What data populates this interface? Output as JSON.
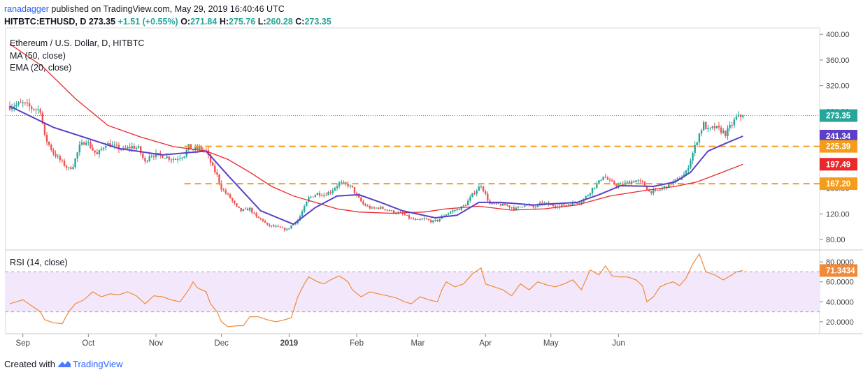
{
  "header": {
    "author": "ranadagger",
    "published_text": " published on TradingView.com, May 29, 2019 16:40:46 UTC",
    "symbol": "HITBTC:ETHUSD, D ",
    "last_price": "273.35",
    "change": "+1.51 (+0.55%)",
    "open_label": "O:",
    "open": "271.84",
    "high_label": "H:",
    "high": "275.76",
    "low_label": "L:",
    "low": "260.28",
    "close_label": "C:",
    "close": "273.35"
  },
  "legend": {
    "title": "Ethereum / U.S. Dollar, D, HITBTC",
    "ma": "MA (50, close)",
    "ema": "EMA (20, close)"
  },
  "rsi_legend": "RSI (14, close)",
  "footer": {
    "prefix": "Created with",
    "brand": "TradingView"
  },
  "colors": {
    "up": "#26a69a",
    "down": "#ef5350",
    "ema": "#5b3fc7",
    "ma": "#e8282a",
    "support": "#f59d1b",
    "rsi": "#f08a3a",
    "rsi_band": "#f3e8fb",
    "last": "#26a69a"
  },
  "chart_data": [
    {
      "type": "candlestick",
      "title": "Ethereum / U.S. Dollar, D, HITBTC",
      "x_ticks": [
        "Sep",
        "Oct",
        "Nov",
        "Dec",
        "2019",
        "Feb",
        "Mar",
        "Apr",
        "May",
        "Jun"
      ],
      "y_ticks": [
        "400.00",
        "360.00",
        "320.00",
        "280.00",
        "240.00",
        "200.00",
        "160.00",
        "120.00",
        "80.00"
      ],
      "ylim": [
        65,
        410
      ],
      "price_path": [
        [
          0,
          288
        ],
        [
          6,
          292
        ],
        [
          10,
          285
        ],
        [
          14,
          282
        ],
        [
          16,
          240
        ],
        [
          20,
          215
        ],
        [
          24,
          200
        ],
        [
          27,
          190
        ],
        [
          29,
          196
        ],
        [
          32,
          225
        ],
        [
          35,
          235
        ],
        [
          38,
          220
        ],
        [
          40,
          212
        ],
        [
          44,
          230
        ],
        [
          48,
          225
        ],
        [
          52,
          220
        ],
        [
          56,
          225
        ],
        [
          59,
          222
        ],
        [
          62,
          200
        ],
        [
          64,
          212
        ],
        [
          67,
          212
        ],
        [
          71,
          210
        ],
        [
          74,
          206
        ],
        [
          76,
          206
        ],
        [
          80,
          212
        ],
        [
          82,
          225
        ],
        [
          84,
          220
        ],
        [
          87,
          222
        ],
        [
          90,
          218
        ],
        [
          93,
          192
        ],
        [
          95,
          180
        ],
        [
          97,
          160
        ],
        [
          101,
          145
        ],
        [
          104,
          130
        ],
        [
          106,
          125
        ],
        [
          110,
          128
        ],
        [
          113,
          115
        ],
        [
          116,
          110
        ],
        [
          118,
          102
        ],
        [
          122,
          100
        ],
        [
          124,
          98
        ],
        [
          127,
          95
        ],
        [
          129,
          102
        ],
        [
          132,
          110
        ],
        [
          135,
          130
        ],
        [
          137,
          145
        ],
        [
          141,
          152
        ],
        [
          144,
          150
        ],
        [
          147,
          155
        ],
        [
          151,
          168
        ],
        [
          155,
          165
        ],
        [
          157,
          160
        ],
        [
          159,
          148
        ],
        [
          162,
          135
        ],
        [
          166,
          128
        ],
        [
          169,
          130
        ],
        [
          172,
          128
        ],
        [
          174,
          125
        ],
        [
          177,
          122
        ],
        [
          180,
          120
        ],
        [
          184,
          112
        ],
        [
          187,
          110
        ],
        [
          190,
          112
        ],
        [
          194,
          108
        ],
        [
          196,
          110
        ],
        [
          199,
          118
        ],
        [
          203,
          125
        ],
        [
          206,
          128
        ],
        [
          209,
          135
        ],
        [
          212,
          150
        ],
        [
          216,
          165
        ],
        [
          218,
          150
        ],
        [
          220,
          135
        ],
        [
          224,
          135
        ],
        [
          228,
          133
        ],
        [
          232,
          128
        ],
        [
          236,
          135
        ],
        [
          240,
          130
        ],
        [
          244,
          137
        ],
        [
          248,
          134
        ],
        [
          252,
          132
        ],
        [
          256,
          135
        ],
        [
          260,
          138
        ],
        [
          262,
          140
        ],
        [
          265,
          150
        ],
        [
          267,
          160
        ],
        [
          270,
          170
        ],
        [
          272,
          180
        ],
        [
          275,
          170
        ],
        [
          278,
          165
        ],
        [
          280,
          165
        ],
        [
          284,
          170
        ],
        [
          287,
          172
        ],
        [
          290,
          168
        ],
        [
          293,
          155
        ],
        [
          296,
          155
        ],
        [
          299,
          160
        ],
        [
          302,
          165
        ],
        [
          304,
          170
        ],
        [
          307,
          175
        ],
        [
          310,
          185
        ],
        [
          313,
          215
        ],
        [
          316,
          245
        ],
        [
          318,
          260
        ],
        [
          320,
          250
        ],
        [
          323,
          255
        ],
        [
          326,
          250
        ],
        [
          328,
          245
        ],
        [
          331,
          260
        ],
        [
          333,
          270
        ],
        [
          336,
          273.35
        ]
      ],
      "series": [
        {
          "name": "EMA (20, close)",
          "points": [
            [
              0,
              288
            ],
            [
              20,
              255
            ],
            [
              50,
              222
            ],
            [
              70,
              212
            ],
            [
              90,
              218
            ],
            [
              100,
              180
            ],
            [
              115,
              125
            ],
            [
              130,
              104
            ],
            [
              140,
              130
            ],
            [
              150,
              148
            ],
            [
              160,
              150
            ],
            [
              170,
              138
            ],
            [
              180,
              125
            ],
            [
              195,
              114
            ],
            [
              205,
              118
            ],
            [
              215,
              138
            ],
            [
              225,
              138
            ],
            [
              240,
              134
            ],
            [
              260,
              138
            ],
            [
              270,
              150
            ],
            [
              280,
              164
            ],
            [
              295,
              163
            ],
            [
              305,
              170
            ],
            [
              312,
              185
            ],
            [
              320,
              218
            ],
            [
              328,
              230
            ],
            [
              336,
              241.34
            ]
          ]
        },
        {
          "name": "MA (50, close)",
          "points": [
            [
              0,
              385
            ],
            [
              15,
              350
            ],
            [
              30,
              300
            ],
            [
              45,
              258
            ],
            [
              60,
              240
            ],
            [
              75,
              225
            ],
            [
              90,
              218
            ],
            [
              100,
              205
            ],
            [
              110,
              185
            ],
            [
              120,
              163
            ],
            [
              130,
              148
            ],
            [
              140,
              138
            ],
            [
              150,
              128
            ],
            [
              160,
              123
            ],
            [
              175,
              121
            ],
            [
              190,
              123
            ],
            [
              200,
              128
            ],
            [
              215,
              132
            ],
            [
              230,
              126
            ],
            [
              245,
              128
            ],
            [
              260,
              134
            ],
            [
              275,
              148
            ],
            [
              290,
              156
            ],
            [
              305,
              163
            ],
            [
              315,
              170
            ],
            [
              325,
              183
            ],
            [
              336,
              197.49
            ]
          ]
        }
      ],
      "support_levels": [
        225.39,
        167.2
      ],
      "price_labels": [
        {
          "label": "273.35",
          "value": 273.35
        },
        {
          "label": "241.34",
          "value": 241.34
        },
        {
          "label": "225.39",
          "value": 225.39
        },
        {
          "label": "197.49",
          "value": 197.49
        },
        {
          "label": "167.20",
          "value": 167.2
        }
      ]
    },
    {
      "type": "line",
      "title": "RSI (14, close)",
      "y_ticks": [
        "80.0000",
        "60.0000",
        "40.0000",
        "20.0000"
      ],
      "ylim": [
        8,
        92
      ],
      "band": [
        30,
        70
      ],
      "last_label": "71.3434",
      "last_value": 71.34,
      "points": [
        [
          0,
          38
        ],
        [
          6,
          42
        ],
        [
          10,
          36
        ],
        [
          14,
          30
        ],
        [
          16,
          22
        ],
        [
          20,
          19
        ],
        [
          24,
          18
        ],
        [
          27,
          30
        ],
        [
          30,
          38
        ],
        [
          34,
          42
        ],
        [
          38,
          50
        ],
        [
          42,
          45
        ],
        [
          46,
          48
        ],
        [
          50,
          47
        ],
        [
          54,
          50
        ],
        [
          58,
          46
        ],
        [
          62,
          38
        ],
        [
          66,
          46
        ],
        [
          70,
          45
        ],
        [
          74,
          42
        ],
        [
          78,
          40
        ],
        [
          82,
          52
        ],
        [
          84,
          60
        ],
        [
          86,
          54
        ],
        [
          90,
          50
        ],
        [
          92,
          38
        ],
        [
          95,
          30
        ],
        [
          97,
          20
        ],
        [
          100,
          15
        ],
        [
          104,
          16
        ],
        [
          107,
          16
        ],
        [
          110,
          25
        ],
        [
          114,
          25
        ],
        [
          118,
          22
        ],
        [
          122,
          20
        ],
        [
          126,
          22
        ],
        [
          129,
          24
        ],
        [
          132,
          45
        ],
        [
          135,
          58
        ],
        [
          137,
          65
        ],
        [
          141,
          60
        ],
        [
          144,
          58
        ],
        [
          147,
          62
        ],
        [
          151,
          66
        ],
        [
          155,
          60
        ],
        [
          157,
          52
        ],
        [
          161,
          45
        ],
        [
          165,
          50
        ],
        [
          169,
          48
        ],
        [
          173,
          46
        ],
        [
          177,
          44
        ],
        [
          181,
          40
        ],
        [
          184,
          38
        ],
        [
          188,
          45
        ],
        [
          192,
          42
        ],
        [
          196,
          40
        ],
        [
          198,
          52
        ],
        [
          200,
          60
        ],
        [
          204,
          55
        ],
        [
          208,
          58
        ],
        [
          212,
          68
        ],
        [
          216,
          74
        ],
        [
          218,
          58
        ],
        [
          222,
          55
        ],
        [
          226,
          52
        ],
        [
          230,
          46
        ],
        [
          234,
          58
        ],
        [
          238,
          52
        ],
        [
          242,
          60
        ],
        [
          246,
          57
        ],
        [
          250,
          55
        ],
        [
          254,
          58
        ],
        [
          258,
          62
        ],
        [
          262,
          52
        ],
        [
          264,
          62
        ],
        [
          266,
          72
        ],
        [
          270,
          67
        ],
        [
          273,
          76
        ],
        [
          276,
          66
        ],
        [
          279,
          65
        ],
        [
          283,
          65
        ],
        [
          287,
          62
        ],
        [
          290,
          56
        ],
        [
          292,
          40
        ],
        [
          295,
          45
        ],
        [
          298,
          55
        ],
        [
          301,
          58
        ],
        [
          304,
          60
        ],
        [
          307,
          56
        ],
        [
          310,
          64
        ],
        [
          313,
          78
        ],
        [
          316,
          88
        ],
        [
          319,
          70
        ],
        [
          323,
          67
        ],
        [
          327,
          62
        ],
        [
          331,
          67
        ],
        [
          333,
          70
        ],
        [
          336,
          71.34
        ]
      ]
    }
  ]
}
